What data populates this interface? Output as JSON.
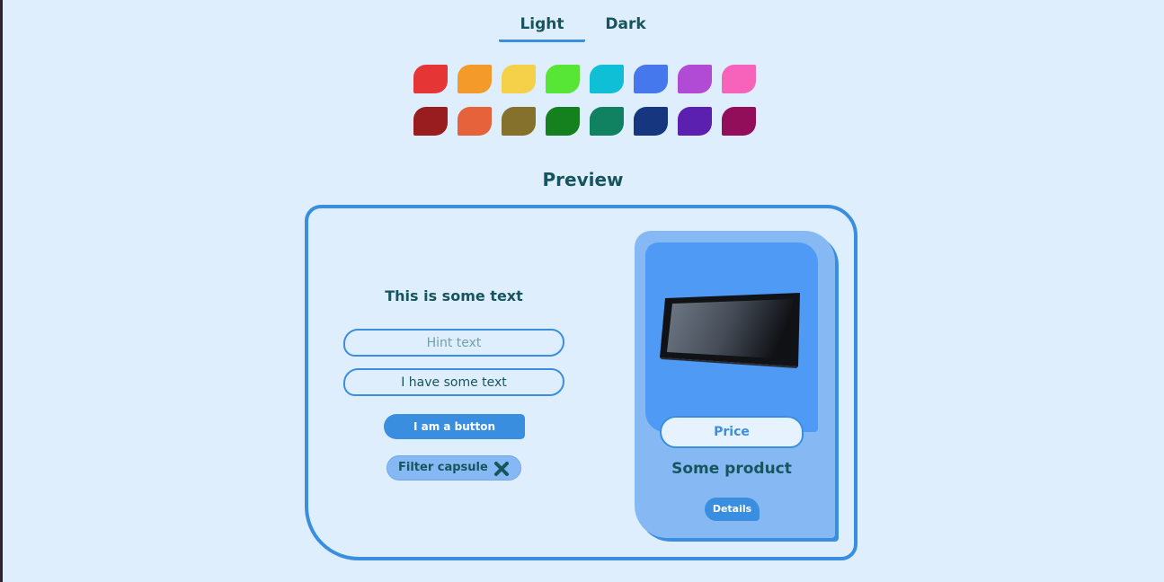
{
  "theme_tabs": {
    "light_label": "Light",
    "dark_label": "Dark",
    "selected": "Light"
  },
  "color_swatches": {
    "row_1": [
      "#e53535",
      "#f39a2a",
      "#f5d14a",
      "#58e636",
      "#0fbfd6",
      "#4478ec",
      "#b14ad4",
      "#f763bb"
    ],
    "row_2": [
      "#991d1f",
      "#e6623a",
      "#85712b",
      "#15811e",
      "#118261",
      "#16377f",
      "#5c20b0",
      "#920e5a"
    ]
  },
  "preview": {
    "heading": "Preview",
    "sample_text": "This is some text",
    "hint_field": {
      "placeholder": "Hint text"
    },
    "text_field": {
      "value": "I have some text"
    },
    "button_label": "I am a button",
    "filter_capsule_label": "Filter capsule",
    "product_card": {
      "image_icon": "tablet-image",
      "price_label": "Price",
      "product_name": "Some product",
      "details_label": "Details"
    }
  },
  "colors": {
    "background": "#dfeefc",
    "accent": "#3a8ee0",
    "text": "#17555e",
    "card_fill": "#86b9f4",
    "image_fill": "#4f9af5"
  }
}
